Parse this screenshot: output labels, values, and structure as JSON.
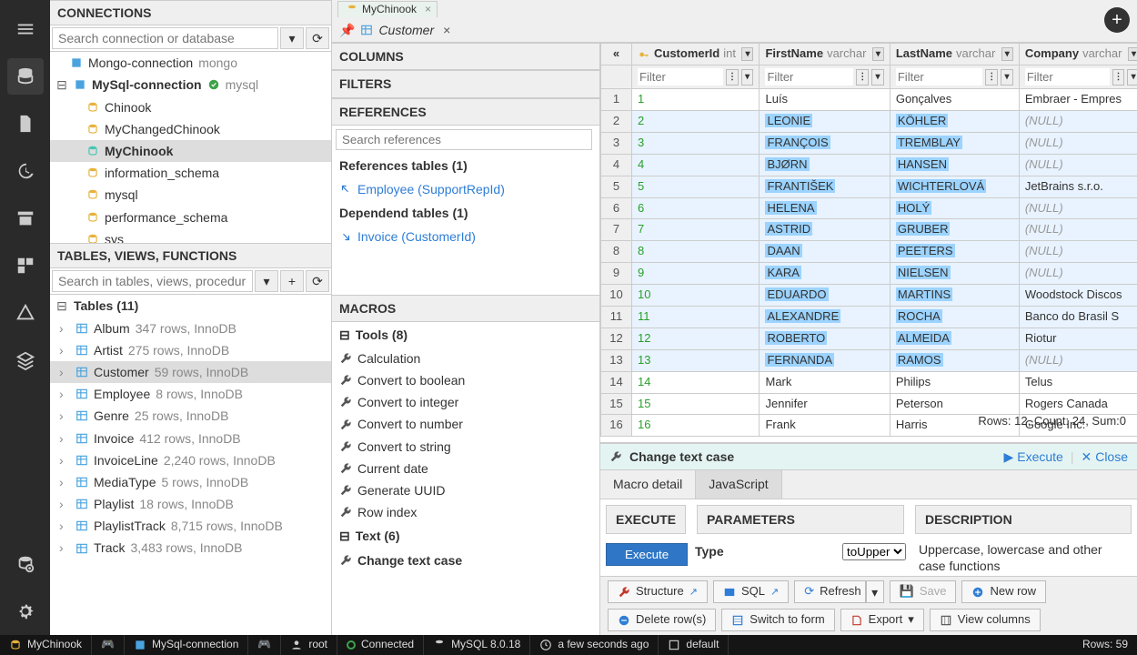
{
  "connections": {
    "title": "CONNECTIONS",
    "search_placeholder": "Search connection or database",
    "items": [
      {
        "name": "Mongo-connection",
        "engine": "mongo",
        "icon": "server-icon"
      },
      {
        "name": "MySql-connection",
        "engine": "mysql",
        "icon": "server-icon",
        "expanded": true,
        "ok": true,
        "children": [
          {
            "name": "Chinook"
          },
          {
            "name": "MyChangedChinook"
          },
          {
            "name": "MyChinook",
            "selected": true
          },
          {
            "name": "information_schema"
          },
          {
            "name": "mysql"
          },
          {
            "name": "performance_schema"
          },
          {
            "name": "sys"
          }
        ]
      }
    ]
  },
  "tables_panel": {
    "title": "TABLES, VIEWS, FUNCTIONS",
    "search_placeholder": "Search in tables, views, procedures",
    "group_label": "Tables (11)",
    "tables": [
      {
        "name": "Album",
        "meta": "347 rows, InnoDB"
      },
      {
        "name": "Artist",
        "meta": "275 rows, InnoDB"
      },
      {
        "name": "Customer",
        "meta": "59 rows, InnoDB",
        "selected": true
      },
      {
        "name": "Employee",
        "meta": "8 rows, InnoDB"
      },
      {
        "name": "Genre",
        "meta": "25 rows, InnoDB"
      },
      {
        "name": "Invoice",
        "meta": "412 rows, InnoDB"
      },
      {
        "name": "InvoiceLine",
        "meta": "2,240 rows, InnoDB"
      },
      {
        "name": "MediaType",
        "meta": "5 rows, InnoDB"
      },
      {
        "name": "Playlist",
        "meta": "18 rows, InnoDB"
      },
      {
        "name": "PlaylistTrack",
        "meta": "8,715 rows, InnoDB"
      },
      {
        "name": "Track",
        "meta": "3,483 rows, InnoDB"
      }
    ]
  },
  "tabs": {
    "main_tab": "MyChinook",
    "sub_tab": "Customer"
  },
  "mid": {
    "columns_title": "COLUMNS",
    "filters_title": "FILTERS",
    "references_title": "REFERENCES",
    "ref_search_placeholder": "Search references",
    "ref_tables_label": "References tables (1)",
    "ref_link1": "Employee (SupportRepId)",
    "dep_tables_label": "Dependend tables (1)",
    "dep_link1": "Invoice (CustomerId)",
    "macros_title": "MACROS",
    "tools_group": "Tools (8)",
    "tools": [
      "Calculation",
      "Convert to boolean",
      "Convert to integer",
      "Convert to number",
      "Convert to string",
      "Current date",
      "Generate UUID",
      "Row index"
    ],
    "text_group": "Text (6)",
    "text_items": [
      "Change text case"
    ]
  },
  "grid": {
    "columns": [
      {
        "name": "CustomerId",
        "type": "int"
      },
      {
        "name": "FirstName",
        "type": "varchar"
      },
      {
        "name": "LastName",
        "type": "varchar"
      },
      {
        "name": "Company",
        "type": "varchar"
      }
    ],
    "filter_placeholder": "Filter",
    "rows": [
      {
        "n": 1,
        "id": "1",
        "first": "Luís",
        "last": "Gonçalves",
        "company": "Embraer - Empres",
        "hl": false
      },
      {
        "n": 2,
        "id": "2",
        "first": "LEONIE",
        "last": "KÖHLER",
        "company": "(NULL)",
        "hl": true
      },
      {
        "n": 3,
        "id": "3",
        "first": "FRANÇOIS",
        "last": "TREMBLAY",
        "company": "(NULL)",
        "hl": true
      },
      {
        "n": 4,
        "id": "4",
        "first": "BJØRN",
        "last": "HANSEN",
        "company": "(NULL)",
        "hl": true
      },
      {
        "n": 5,
        "id": "5",
        "first": "FRANTIŠEK",
        "last": "WICHTERLOVÁ",
        "company": "JetBrains s.r.o.",
        "hl": true
      },
      {
        "n": 6,
        "id": "6",
        "first": "HELENA",
        "last": "HOLÝ",
        "company": "(NULL)",
        "hl": true
      },
      {
        "n": 7,
        "id": "7",
        "first": "ASTRID",
        "last": "GRUBER",
        "company": "(NULL)",
        "hl": true
      },
      {
        "n": 8,
        "id": "8",
        "first": "DAAN",
        "last": "PEETERS",
        "company": "(NULL)",
        "hl": true
      },
      {
        "n": 9,
        "id": "9",
        "first": "KARA",
        "last": "NIELSEN",
        "company": "(NULL)",
        "hl": true
      },
      {
        "n": 10,
        "id": "10",
        "first": "EDUARDO",
        "last": "MARTINS",
        "company": "Woodstock Discos",
        "hl": true
      },
      {
        "n": 11,
        "id": "11",
        "first": "ALEXANDRE",
        "last": "ROCHA",
        "company": "Banco do Brasil S",
        "hl": true
      },
      {
        "n": 12,
        "id": "12",
        "first": "ROBERTO",
        "last": "ALMEIDA",
        "company": "Riotur",
        "hl": true
      },
      {
        "n": 13,
        "id": "13",
        "first": "FERNANDA",
        "last": "RAMOS",
        "company": "(NULL)",
        "hl": true
      },
      {
        "n": 14,
        "id": "14",
        "first": "Mark",
        "last": "Philips",
        "company": "Telus",
        "hl": false
      },
      {
        "n": 15,
        "id": "15",
        "first": "Jennifer",
        "last": "Peterson",
        "company": "Rogers Canada",
        "hl": false
      },
      {
        "n": 16,
        "id": "16",
        "first": "Frank",
        "last": "Harris",
        "company": "Google Inc.",
        "hl": false
      }
    ],
    "selection_status": "Rows: 12, Count: 24, Sum:0"
  },
  "macro_panel": {
    "title": "Change text case",
    "execute_link": "Execute",
    "close_link": "Close",
    "tab1": "Macro detail",
    "tab2": "JavaScript",
    "execute_header": "EXECUTE",
    "execute_btn": "Execute",
    "params_header": "PARAMETERS",
    "param1_label": "Type",
    "param1_value": "toUpper",
    "desc_header": "DESCRIPTION",
    "desc_text": "Uppercase, lowercase and other case functions"
  },
  "toolbar": {
    "structure": "Structure",
    "sql": "SQL",
    "refresh": "Refresh",
    "save": "Save",
    "new_row": "New row",
    "delete_rows": "Delete row(s)",
    "switch_form": "Switch to form",
    "export": "Export",
    "view_columns": "View columns"
  },
  "status": {
    "db": "MyChinook",
    "conn": "MySql-connection",
    "user": "root",
    "state": "Connected",
    "server": "MySQL 8.0.18",
    "time": "a few seconds ago",
    "schema": "default",
    "rows": "Rows: 59"
  }
}
